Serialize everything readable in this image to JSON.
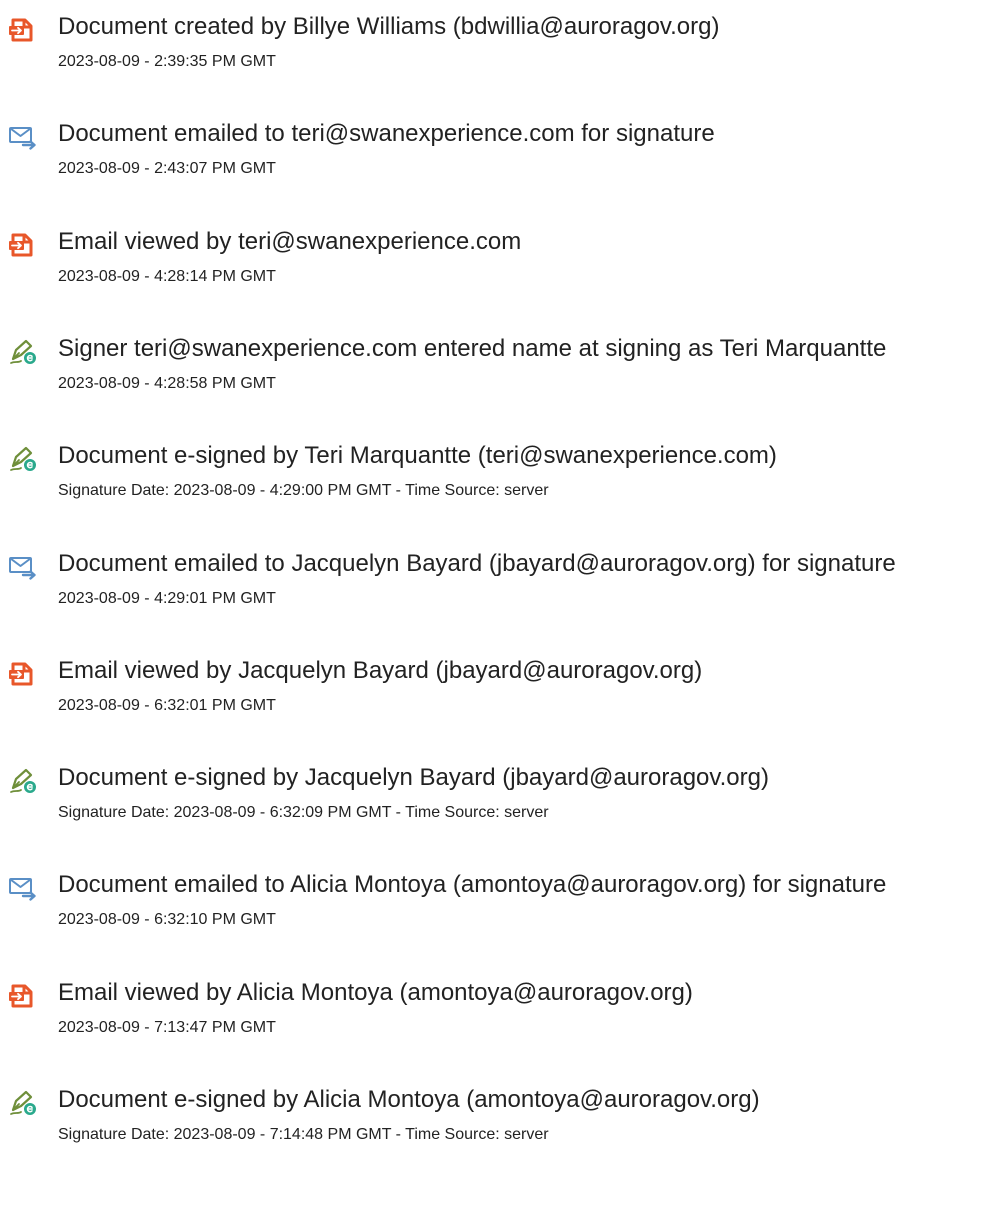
{
  "colors": {
    "view_icon": "#e8572a",
    "email_icon": "#5a8fc6",
    "sign_icon": "#6f8f3a",
    "sign_badge": "#2aa98c",
    "text": "#222222"
  },
  "events": [
    {
      "icon": "document-view-icon",
      "title": "Document created by Billye Williams (bdwillia@auroragov.org)",
      "date": "2023-08-09 - 2:39:35 PM GMT"
    },
    {
      "icon": "email-send-icon",
      "title": "Document emailed to teri@swanexperience.com for signature",
      "date": "2023-08-09 - 2:43:07 PM GMT"
    },
    {
      "icon": "document-view-icon",
      "title": "Email viewed by teri@swanexperience.com",
      "date": "2023-08-09 - 4:28:14 PM GMT"
    },
    {
      "icon": "e-sign-pen-icon",
      "title": "Signer teri@swanexperience.com entered name at signing as Teri Marquantte",
      "date": "2023-08-09 - 4:28:58 PM GMT"
    },
    {
      "icon": "e-sign-pen-icon",
      "title": "Document e-signed by Teri Marquantte (teri@swanexperience.com)",
      "date": "Signature Date: 2023-08-09 - 4:29:00 PM GMT - Time Source: server"
    },
    {
      "icon": "email-send-icon",
      "title": "Document emailed to Jacquelyn Bayard (jbayard@auroragov.org) for signature",
      "date": "2023-08-09 - 4:29:01 PM GMT"
    },
    {
      "icon": "document-view-icon",
      "title": "Email viewed by Jacquelyn Bayard (jbayard@auroragov.org)",
      "date": "2023-08-09 - 6:32:01 PM GMT"
    },
    {
      "icon": "e-sign-pen-icon",
      "title": "Document e-signed by Jacquelyn Bayard (jbayard@auroragov.org)",
      "date": "Signature Date: 2023-08-09 - 6:32:09 PM GMT - Time Source: server"
    },
    {
      "icon": "email-send-icon",
      "title": "Document emailed to Alicia Montoya (amontoya@auroragov.org) for signature",
      "date": "2023-08-09 - 6:32:10 PM GMT"
    },
    {
      "icon": "document-view-icon",
      "title": "Email viewed by Alicia Montoya (amontoya@auroragov.org)",
      "date": "2023-08-09 - 7:13:47 PM GMT"
    },
    {
      "icon": "e-sign-pen-icon",
      "title": "Document e-signed by Alicia Montoya (amontoya@auroragov.org)",
      "date": "Signature Date: 2023-08-09 - 7:14:48 PM GMT - Time Source: server"
    }
  ]
}
